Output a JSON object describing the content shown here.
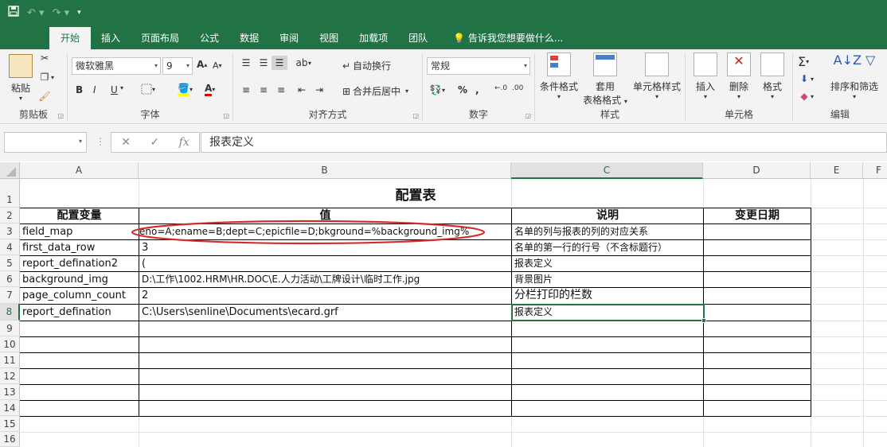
{
  "qat": {
    "save_icon": "save-icon",
    "undo_icon": "undo-icon",
    "redo_icon": "redo-icon",
    "customize_icon": "customize-icon"
  },
  "tabs": [
    {
      "label": "开始",
      "active": true
    },
    {
      "label": "插入"
    },
    {
      "label": "页面布局"
    },
    {
      "label": "公式"
    },
    {
      "label": "数据"
    },
    {
      "label": "审阅"
    },
    {
      "label": "视图"
    },
    {
      "label": "加载项"
    },
    {
      "label": "团队"
    }
  ],
  "tell_me": "告诉我您想要做什么...",
  "ribbon": {
    "clipboard": {
      "label": "剪贴板",
      "paste": "粘贴"
    },
    "font": {
      "label": "字体",
      "font_name": "微软雅黑",
      "font_size": "9",
      "bold": "B",
      "italic": "I",
      "underline": "U"
    },
    "alignment": {
      "label": "对齐方式",
      "wrap": "自动换行",
      "merge": "合并后居中"
    },
    "number": {
      "label": "数字",
      "format": "常规",
      "percent": "%",
      "comma": ","
    },
    "styles": {
      "label": "样式",
      "conditional": "条件格式",
      "table_format_1": "套用",
      "table_format_2": "表格格式",
      "cell_styles": "单元格样式"
    },
    "cells": {
      "label": "单元格",
      "insert": "插入",
      "delete": "删除",
      "format": "格式"
    },
    "editing": {
      "label": "编辑",
      "sort": "排序和筛选"
    }
  },
  "formula_bar": {
    "name_box": "",
    "fx": "fx",
    "content": "报表定义"
  },
  "columns": [
    "A",
    "B",
    "C",
    "D",
    "E",
    "F"
  ],
  "rows": [
    "1",
    "2",
    "3",
    "4",
    "5",
    "6",
    "7",
    "8",
    "9",
    "10",
    "11",
    "12",
    "13",
    "14",
    "15",
    "16"
  ],
  "sheet": {
    "title": "配置表",
    "headers": [
      "配置变量",
      "值",
      "说明",
      "变更日期"
    ],
    "data": [
      {
        "var": "field_map",
        "value": "eno=A;ename=B;dept=C;epicfile=D;bkground=%background_img%",
        "desc": "名单的列与报表的列的对应关系",
        "date": ""
      },
      {
        "var": "first_data_row",
        "value": "3",
        "desc": "名单的第一行的行号（不含标题行）",
        "date": ""
      },
      {
        "var": "report_defination2",
        "value": "(",
        "desc": "报表定义",
        "date": ""
      },
      {
        "var": "background_img",
        "value": "D:\\工作\\1002.HRM\\HR.DOC\\E.人力活动\\工牌设计\\临时工作.jpg",
        "desc": "背景图片",
        "date": ""
      },
      {
        "var": "page_column_count",
        "value": "2",
        "desc": "分栏打印的栏数",
        "date": ""
      },
      {
        "var": "report_defination",
        "value": "C:\\Users\\senline\\Documents\\ecard.grf",
        "desc": "报表定义",
        "date": ""
      }
    ]
  }
}
